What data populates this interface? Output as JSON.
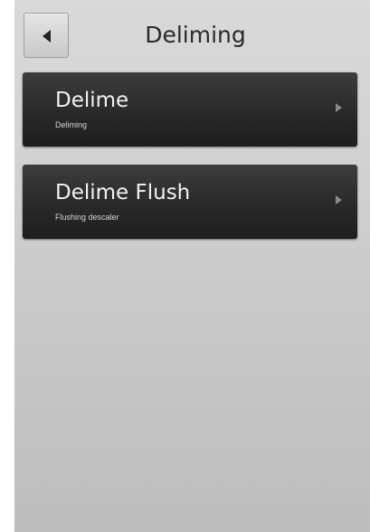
{
  "header": {
    "back_label": "",
    "title": "Deliming",
    "back_icon": "back-arrow-icon"
  },
  "menu": {
    "items": [
      {
        "title": "Delime",
        "subtitle": "Deliming",
        "icon": "chevron-right-icon"
      },
      {
        "title": "Delime Flush",
        "subtitle": "Flushing descaler",
        "icon": "chevron-right-icon"
      }
    ]
  },
  "colors": {
    "background": "#cfcfcf",
    "item_background": "#2b2b2b",
    "item_text": "#f2f2f2",
    "title_text": "#2a2a2a"
  }
}
